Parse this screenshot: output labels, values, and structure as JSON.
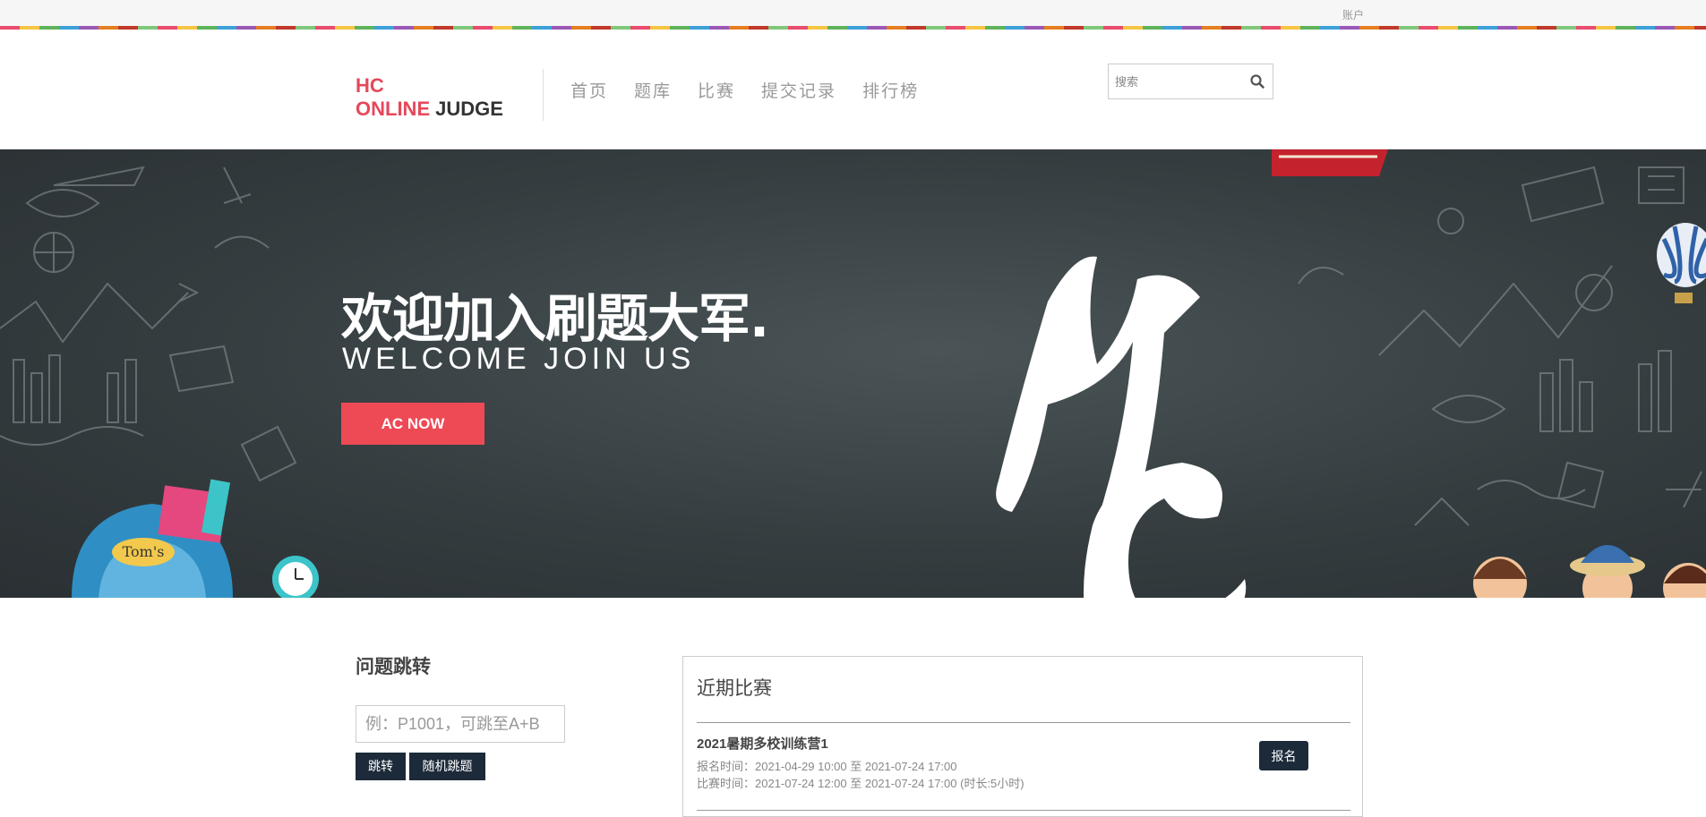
{
  "topbar": {
    "account": "账户"
  },
  "logo": {
    "line1": "HC",
    "line2a": "ONLINE",
    "line2b": "JUDGE"
  },
  "nav": {
    "items": [
      "首页",
      "题库",
      "比赛",
      "提交记录",
      "排行榜"
    ]
  },
  "search": {
    "placeholder": "搜索",
    "icon": "search-icon"
  },
  "banner": {
    "headline": "欢迎加入刷题大军.",
    "subheadline": "WELCOME JOIN US",
    "cta_label": "AC NOW",
    "brush_text": "HC",
    "backpack_label": "Tom's"
  },
  "jump": {
    "title": "问题跳转",
    "input_placeholder": "例：P1001，可跳至A+B",
    "jump_label": "跳转",
    "random_label": "随机跳题"
  },
  "contests": {
    "title": "近期比赛",
    "items": [
      {
        "name": "2021暑期多校训练营1",
        "signup_time": "报名时间：2021-04-29 10:00 至 2021-07-24 17:00",
        "contest_time": "比赛时间：2021-07-24 12:00 至 2021-07-24 17:00 (时长:5小时)",
        "signup_label": "报名"
      }
    ]
  },
  "colors": {
    "brand_red": "#e5485a",
    "cta_red": "#ee4a55",
    "dark_button": "#1c2a3a",
    "nav_gray": "#999999"
  }
}
